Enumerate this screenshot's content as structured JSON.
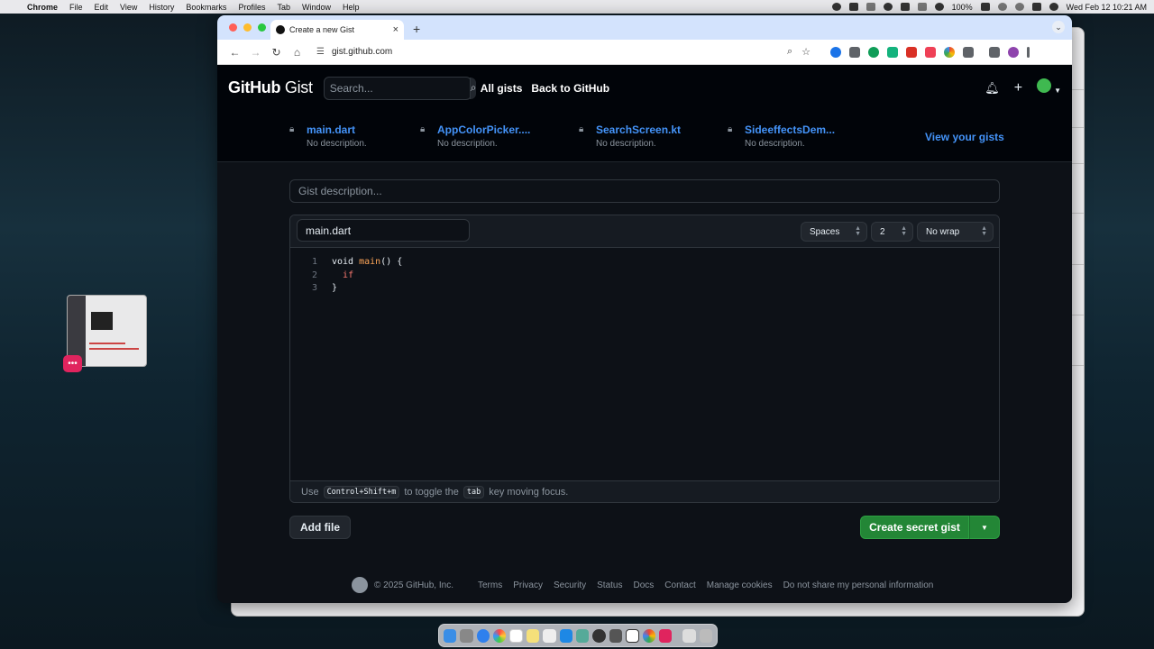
{
  "menubar": {
    "items": [
      "Chrome",
      "File",
      "Edit",
      "View",
      "History",
      "Bookmarks",
      "Profiles",
      "Tab",
      "Window",
      "Help"
    ],
    "battery": "100%",
    "datetime": "Wed Feb 12  10:21 AM"
  },
  "browser": {
    "tab_title": "Create a new Gist",
    "url": "gist.github.com"
  },
  "gist_header": {
    "logo_bold": "GitHub",
    "logo_light": " Gist",
    "search_placeholder": "Search...",
    "nav": [
      "All gists",
      "Back to GitHub"
    ]
  },
  "recent_gists": [
    {
      "name": "main.dart",
      "description": "No description."
    },
    {
      "name": "AppColorPicker....",
      "description": "No description."
    },
    {
      "name": "SearchScreen.kt",
      "description": "No description."
    },
    {
      "name": "SideeffectsDem...",
      "description": "No description."
    }
  ],
  "view_your_gists": "View your gists",
  "form": {
    "description_placeholder": "Gist description...",
    "filename": "main.dart",
    "indent_mode": "Spaces",
    "indent_size": "2",
    "wrap_mode": "No wrap",
    "code_lines": [
      {
        "num": "1",
        "parts": [
          "void ",
          "main",
          "() {"
        ]
      },
      {
        "num": "2",
        "parts": [
          "  ",
          "if",
          ""
        ]
      },
      {
        "num": "3",
        "parts": [
          "}",
          "",
          ""
        ]
      }
    ],
    "hint": {
      "pre": "Use",
      "kbd1": "Control+Shift+m",
      "mid": "to toggle the",
      "kbd2": "tab",
      "post": "key moving focus."
    },
    "add_file": "Add file",
    "create": "Create secret gist"
  },
  "footer": {
    "copyright": "© 2025 GitHub, Inc.",
    "links": [
      "Terms",
      "Privacy",
      "Security",
      "Status",
      "Docs",
      "Contact",
      "Manage cookies",
      "Do not share my personal information"
    ]
  },
  "colors": {
    "accent_link": "#4493f8",
    "create_green": "#238636",
    "bg": "#0d1117"
  }
}
